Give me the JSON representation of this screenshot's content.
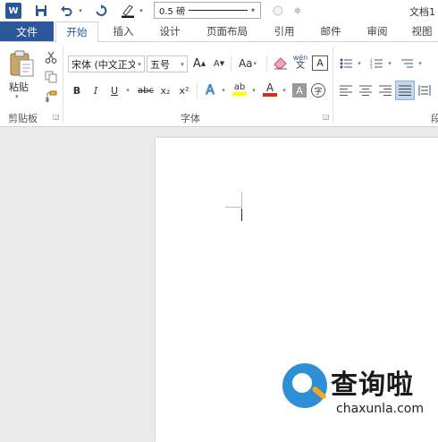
{
  "app_logo": "W",
  "window_title": "文档1",
  "qat": {
    "save": "save-icon",
    "undo": "undo-icon",
    "redo": "redo-icon",
    "pen_color": "#1a1a1a",
    "line_weight": "0.5 磅",
    "more": "≑"
  },
  "tabs": [
    "文件",
    "开始",
    "插入",
    "设计",
    "页面布局",
    "引用",
    "邮件",
    "审阅",
    "视图"
  ],
  "ribbon": {
    "clipboard": {
      "paste": "粘贴",
      "label": "剪贴板"
    },
    "font": {
      "family": "宋体 (中文正文",
      "size": "五号",
      "grow": "A",
      "shrink": "A",
      "case": "Aa",
      "phonetic": "wén",
      "bold": "B",
      "italic": "I",
      "underline": "U",
      "strike": "abc",
      "subscript": "x₂",
      "superscript": "x²",
      "text_effect": "A",
      "highlight": "ab",
      "highlight_color": "#ffff00",
      "font_color": "A",
      "font_color_value": "#d12b2b",
      "char_shading": "A",
      "enclose": "字",
      "label": "字体"
    },
    "paragraph": {
      "label": "段"
    }
  },
  "watermark": {
    "title": "查询啦",
    "url": "chaxunla.com"
  },
  "colors": {
    "accent": "#2b579a",
    "watermark_blue": "#2e8fd6",
    "watermark_orange": "#f5a623"
  }
}
